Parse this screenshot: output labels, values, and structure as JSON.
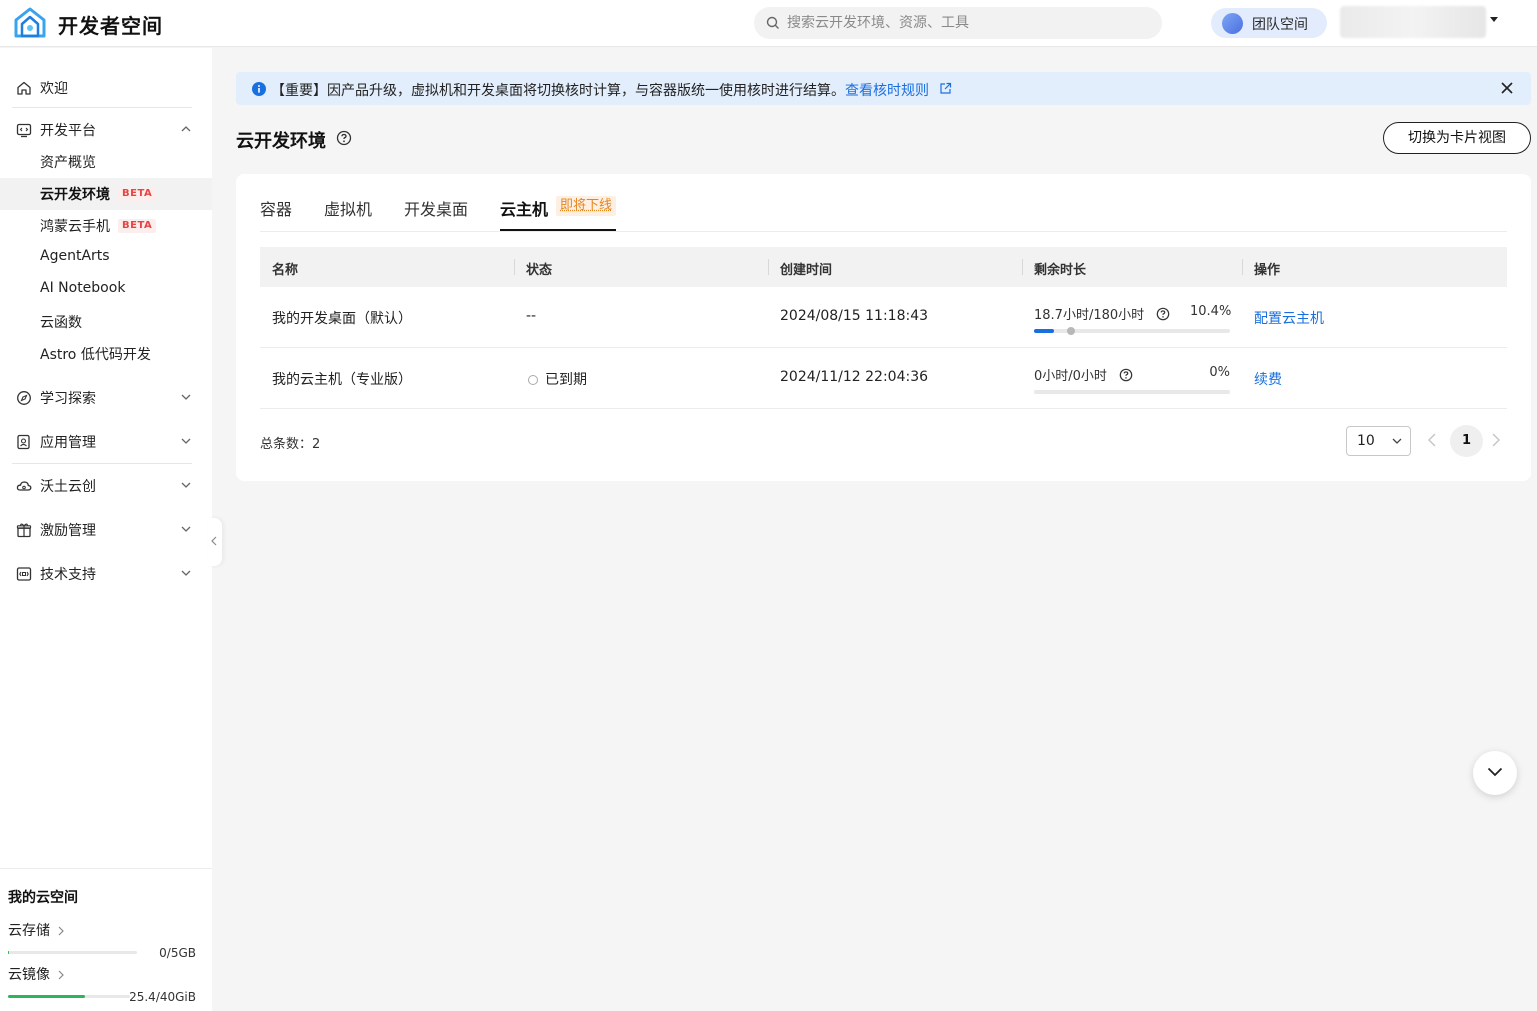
{
  "header": {
    "app_title": "开发者空间",
    "search_placeholder": "搜索云开发环境、资源、工具",
    "team_label": "团队空间"
  },
  "sidebar": {
    "welcome": "欢迎",
    "dev_platform": "开发平台",
    "sub_items": [
      {
        "label": "资产概览",
        "beta": ""
      },
      {
        "label": "云开发环境",
        "beta": "BETA"
      },
      {
        "label": "鸿蒙云手机",
        "beta": "BETA"
      },
      {
        "label": "AgentArts",
        "beta": ""
      },
      {
        "label": "AI Notebook",
        "beta": ""
      },
      {
        "label": "云函数",
        "beta": ""
      },
      {
        "label": "Astro 低代码开发",
        "beta": ""
      }
    ],
    "groups": [
      "学习探索",
      "应用管理",
      "沃土云创",
      "激励管理",
      "技术支持"
    ],
    "my_space": {
      "title": "我的云空间",
      "storage": {
        "label": "云存储",
        "value": "0/5GB",
        "fraction": 0.01,
        "color": "#2db55d"
      },
      "mirror": {
        "label": "云镜像",
        "value": "25.4/40GiB",
        "fraction": 0.635,
        "color": "#2db55d"
      }
    }
  },
  "notice": {
    "text": "【重要】因产品升级，虚拟机和开发桌面将切换核时计算，与容器版统一使用核时进行结算。",
    "link": "查看核时规则"
  },
  "page": {
    "title": "云开发环境",
    "switch_button": "切换为卡片视图"
  },
  "tabs": [
    {
      "label": "容器"
    },
    {
      "label": "虚拟机"
    },
    {
      "label": "开发桌面"
    },
    {
      "label": "云主机",
      "badge": "即将下线"
    }
  ],
  "table": {
    "headers": [
      "名称",
      "状态",
      "创建时间",
      "剩余时长",
      "操作"
    ],
    "rows": [
      {
        "name": "我的开发桌面（默认）",
        "status": "--",
        "created": "2024/08/15 11:18:43",
        "duration": "18.7小时/180小时",
        "percent": "10.4%",
        "percent_value": 10.4,
        "action": "配置云主机"
      },
      {
        "name": "我的云主机（专业版）",
        "status": "已到期",
        "created": "2024/11/12 22:04:36",
        "duration": "0小时/0小时",
        "percent": "0%",
        "percent_value": 0,
        "action": "续费"
      }
    ],
    "total_label": "总条数：2",
    "page_size": "10",
    "current_page": "1"
  },
  "colors": {
    "accent": "#1a6fe0",
    "beta": "#e54545",
    "deprecation": "#e6851e",
    "notice_bg": "#e3eefd"
  }
}
